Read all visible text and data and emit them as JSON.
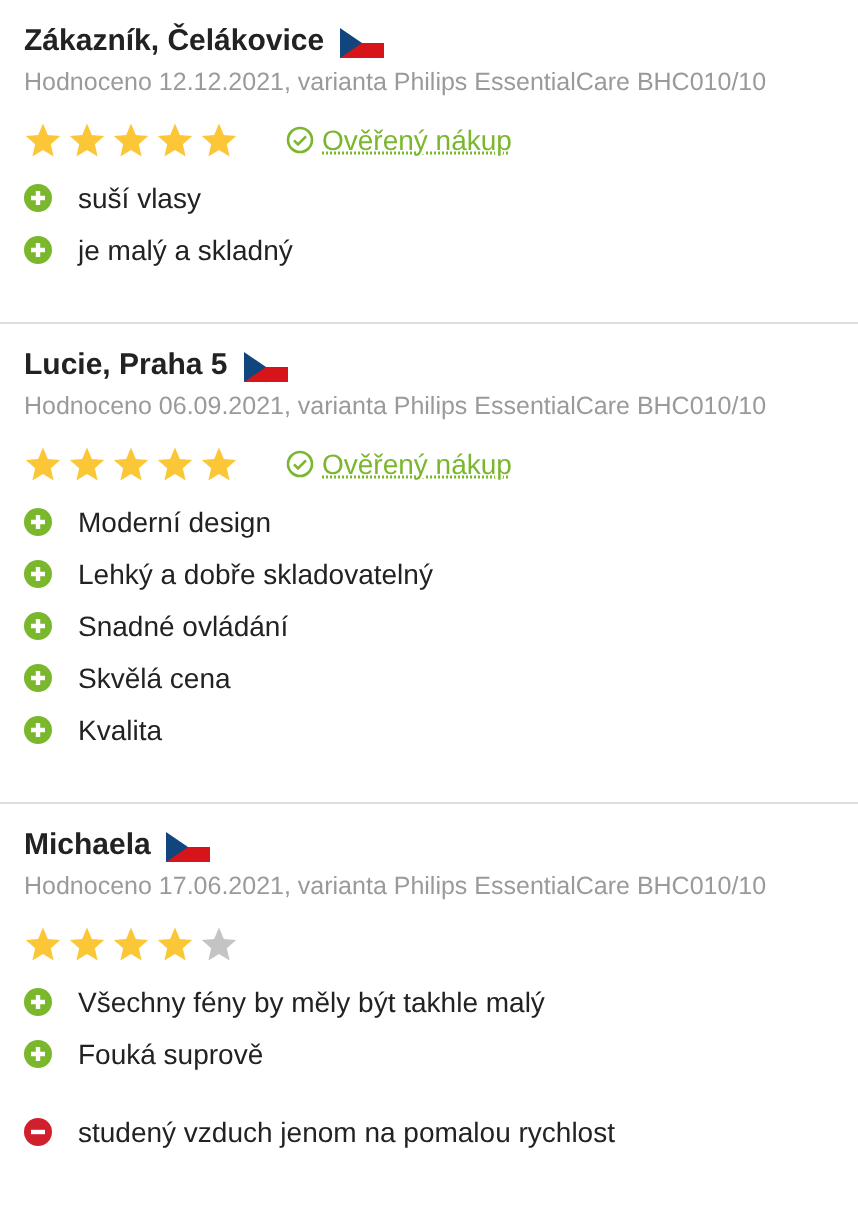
{
  "reviews": [
    {
      "author": "Zákazník, Čelákovice",
      "meta": "Hodnoceno 12.12.2021, varianta Philips EssentialCare BHC010/10",
      "stars": 5,
      "verified": true,
      "verified_label": "Ověřený nákup",
      "points": [
        {
          "kind": "pro",
          "text": "suší vlasy"
        },
        {
          "kind": "pro",
          "text": "je malý a skladný"
        }
      ]
    },
    {
      "author": "Lucie, Praha 5",
      "meta": "Hodnoceno 06.09.2021, varianta Philips EssentialCare BHC010/10",
      "stars": 5,
      "verified": true,
      "verified_label": "Ověřený nákup",
      "points": [
        {
          "kind": "pro",
          "text": "Moderní design"
        },
        {
          "kind": "pro",
          "text": "Lehký a dobře skladovatelný"
        },
        {
          "kind": "pro",
          "text": "Snadné ovládání"
        },
        {
          "kind": "pro",
          "text": "Skvělá cena"
        },
        {
          "kind": "pro",
          "text": "Kvalita"
        }
      ]
    },
    {
      "author": "Michaela",
      "meta": "Hodnoceno 17.06.2021, varianta Philips EssentialCare BHC010/10",
      "stars": 4,
      "verified": false,
      "points": [
        {
          "kind": "pro",
          "text": "Všechny fény by měly být takhle malý"
        },
        {
          "kind": "pro",
          "text": "Fouká suprově"
        },
        {
          "kind": "con",
          "text": "studený vzduch jenom na pomalou rychlost"
        }
      ]
    }
  ]
}
